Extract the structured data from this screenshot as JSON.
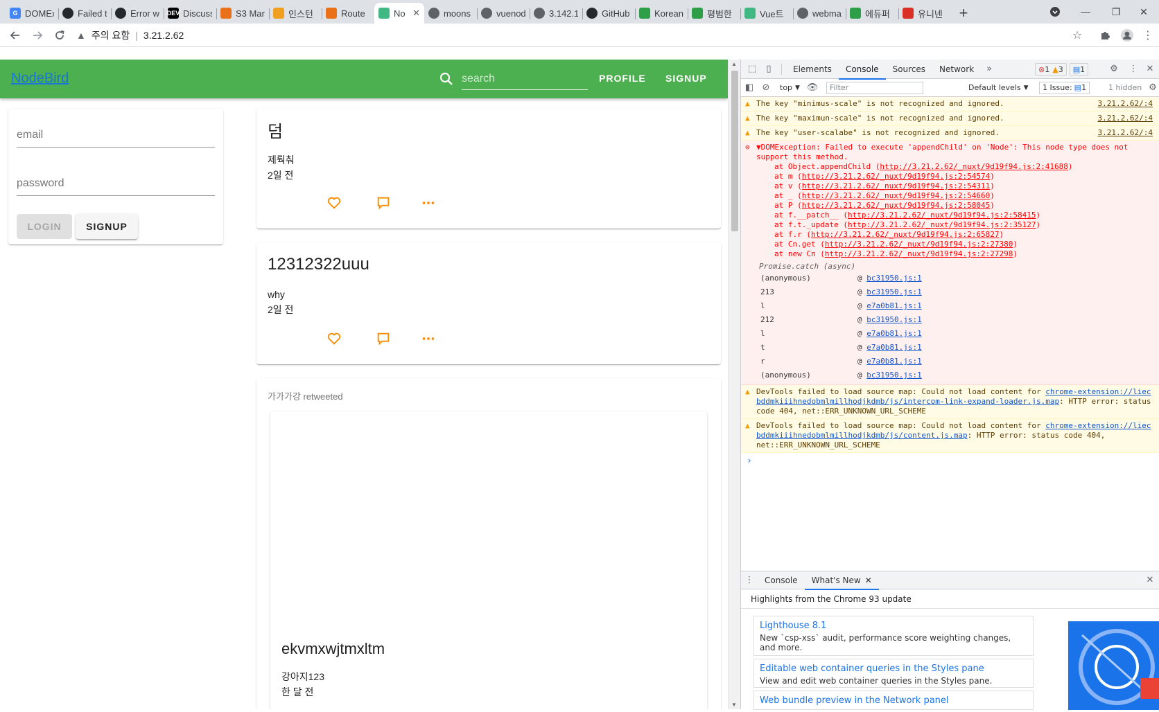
{
  "browser": {
    "tabs": [
      {
        "label": "DOMEx",
        "icon": "google-icon",
        "color": "#4285f4",
        "glyph": "G"
      },
      {
        "label": "Failed t",
        "icon": "github-icon",
        "color": "#24292e",
        "glyph": ""
      },
      {
        "label": "Error w",
        "icon": "github-icon",
        "color": "#24292e",
        "glyph": ""
      },
      {
        "label": "Discuss",
        "icon": "dev-icon",
        "color": "#000000",
        "glyph": "DEV"
      },
      {
        "label": "S3 Mar",
        "icon": "aws-icon",
        "color": "#e8711a",
        "glyph": ""
      },
      {
        "label": "인스턴",
        "icon": "aws-icon",
        "color": "#f0a020",
        "glyph": ""
      },
      {
        "label": "Route",
        "icon": "aws-icon",
        "color": "#e8711a",
        "glyph": ""
      },
      {
        "label": "No",
        "icon": "nuxt-icon",
        "color": "#41b883",
        "glyph": "",
        "active": true
      },
      {
        "label": "moons",
        "icon": "globe-icon",
        "color": "#5f6368",
        "glyph": ""
      },
      {
        "label": "vuenod",
        "icon": "globe-icon",
        "color": "#5f6368",
        "glyph": ""
      },
      {
        "label": "3.142.1",
        "icon": "globe-icon",
        "color": "#5f6368",
        "glyph": ""
      },
      {
        "label": "GitHub",
        "icon": "github-icon",
        "color": "#24292e",
        "glyph": ""
      },
      {
        "label": "Korean",
        "icon": "bookmark-icon",
        "color": "#2e9e48",
        "glyph": ""
      },
      {
        "label": "평범한",
        "icon": "leaf-icon",
        "color": "#2e9e48",
        "glyph": ""
      },
      {
        "label": "Vue트",
        "icon": "vue-icon",
        "color": "#41b883",
        "glyph": ""
      },
      {
        "label": "webma",
        "icon": "globe-icon",
        "color": "#5f6368",
        "glyph": ""
      },
      {
        "label": "에듀퍼",
        "icon": "bookmark-icon",
        "color": "#2e9e48",
        "glyph": ""
      },
      {
        "label": "유니넨",
        "icon": "bookmark-icon",
        "color": "#d93025",
        "glyph": ""
      }
    ],
    "address": {
      "warning": "주의 요함",
      "url": "3.21.2.62"
    }
  },
  "app": {
    "logo": "NodeBird",
    "search_placeholder": "search",
    "nav": {
      "profile": "PROFILE",
      "signup": "SIGNUP"
    },
    "login": {
      "email_placeholder": "email",
      "password_placeholder": "password",
      "login_button": "LOGIN",
      "signup_button": "SIGNUP"
    },
    "posts": [
      {
        "title": "덤",
        "body": "제뤅춰",
        "time": "2일 전"
      },
      {
        "title": "12312322uuu",
        "body": "why",
        "time": "2일 전"
      }
    ],
    "retweet": {
      "label": "가가가강 retweeted",
      "title": "ekvmxwjtmxltm",
      "body": "강아지123",
      "time": "한 달 전"
    },
    "accent": "#4caf50",
    "icon_color": "#fb8c00"
  },
  "devtools": {
    "tabs": [
      "Elements",
      "Console",
      "Sources",
      "Network"
    ],
    "active_tab": "Console",
    "counts": {
      "errors": "1",
      "warnings": "3",
      "info": "1"
    },
    "filterbar": {
      "context": "top",
      "filter_placeholder": "Filter",
      "levels": "Default levels",
      "issues": "1 Issue:",
      "issues_count": "1",
      "hidden": "1 hidden"
    },
    "warnings": [
      {
        "text": "The key \"minimus-scale\" is not recognized and ignored.",
        "src": "3.21.2.62/:4"
      },
      {
        "text": "The key \"maximun-scale\" is not recognized and ignored.",
        "src": "3.21.2.62/:4"
      },
      {
        "text": "The key \"user-scalabe\" is not recognized and ignored.",
        "src": "3.21.2.62/:4"
      }
    ],
    "error": {
      "message": "▼DOMException: Failed to execute 'appendChild' on 'Node': This node type does not support this method.",
      "stack": [
        {
          "at": "at Object.appendChild (",
          "link": "http://3.21.2.62/_nuxt/9d19f94.js:2:41688"
        },
        {
          "at": "at m (",
          "link": "http://3.21.2.62/_nuxt/9d19f94.js:2:54574"
        },
        {
          "at": "at v (",
          "link": "http://3.21.2.62/_nuxt/9d19f94.js:2:54311"
        },
        {
          "at": "at _ (",
          "link": "http://3.21.2.62/_nuxt/9d19f94.js:2:54660"
        },
        {
          "at": "at P (",
          "link": "http://3.21.2.62/_nuxt/9d19f94.js:2:58045"
        },
        {
          "at": "at f.__patch__ (",
          "link": "http://3.21.2.62/_nuxt/9d19f94.js:2:58415"
        },
        {
          "at": "at f.t._update (",
          "link": "http://3.21.2.62/_nuxt/9d19f94.js:2:35127"
        },
        {
          "at": "at f.r (",
          "link": "http://3.21.2.62/_nuxt/9d19f94.js:2:65827"
        },
        {
          "at": "at Cn.get (",
          "link": "http://3.21.2.62/_nuxt/9d19f94.js:2:27380"
        },
        {
          "at": "at new Cn (",
          "link": "http://3.21.2.62/_nuxt/9d19f94.js:2:27298"
        }
      ],
      "async_label": "Promise.catch (async)",
      "frames": [
        {
          "fn": "(anonymous)",
          "file": "bc31950.js:1"
        },
        {
          "fn": "213",
          "file": "bc31950.js:1"
        },
        {
          "fn": "l",
          "file": "e7a0b81.js:1"
        },
        {
          "fn": "212",
          "file": "bc31950.js:1"
        },
        {
          "fn": "l",
          "file": "e7a0b81.js:1"
        },
        {
          "fn": "t",
          "file": "e7a0b81.js:1"
        },
        {
          "fn": "r",
          "file": "e7a0b81.js:1"
        },
        {
          "fn": "(anonymous)",
          "file": "bc31950.js:1"
        }
      ]
    },
    "sourcemap_warnings": [
      {
        "prefix": "DevTools failed to load source map: Could not load content for ",
        "link": "chrome-extension://liecbddmkiiihnedobmlmillhodjkdmb/js/intercom-link-expand-loader.js.map",
        "suffix": ": HTTP error: status code 404, net::ERR_UNKNOWN_URL_SCHEME"
      },
      {
        "prefix": "DevTools failed to load source map: Could not load content for ",
        "link": "chrome-extension://liecbddmkiiihnedobmlmillhodjkdmb/js/content.js.map",
        "suffix": ": HTTP error: status code 404, net::ERR_UNKNOWN_URL_SCHEME"
      }
    ],
    "drawer": {
      "tabs": [
        "Console",
        "What's New"
      ],
      "highlights": "Highlights from the Chrome 93 update",
      "items": [
        {
          "title": "Lighthouse 8.1",
          "desc": "New `csp-xss` audit, performance score weighting changes, and more."
        },
        {
          "title": "Editable web container queries in the Styles pane",
          "desc": "View and edit web container queries in the Styles pane."
        },
        {
          "title": "Web bundle preview in the Network panel",
          "desc": ""
        }
      ]
    }
  }
}
